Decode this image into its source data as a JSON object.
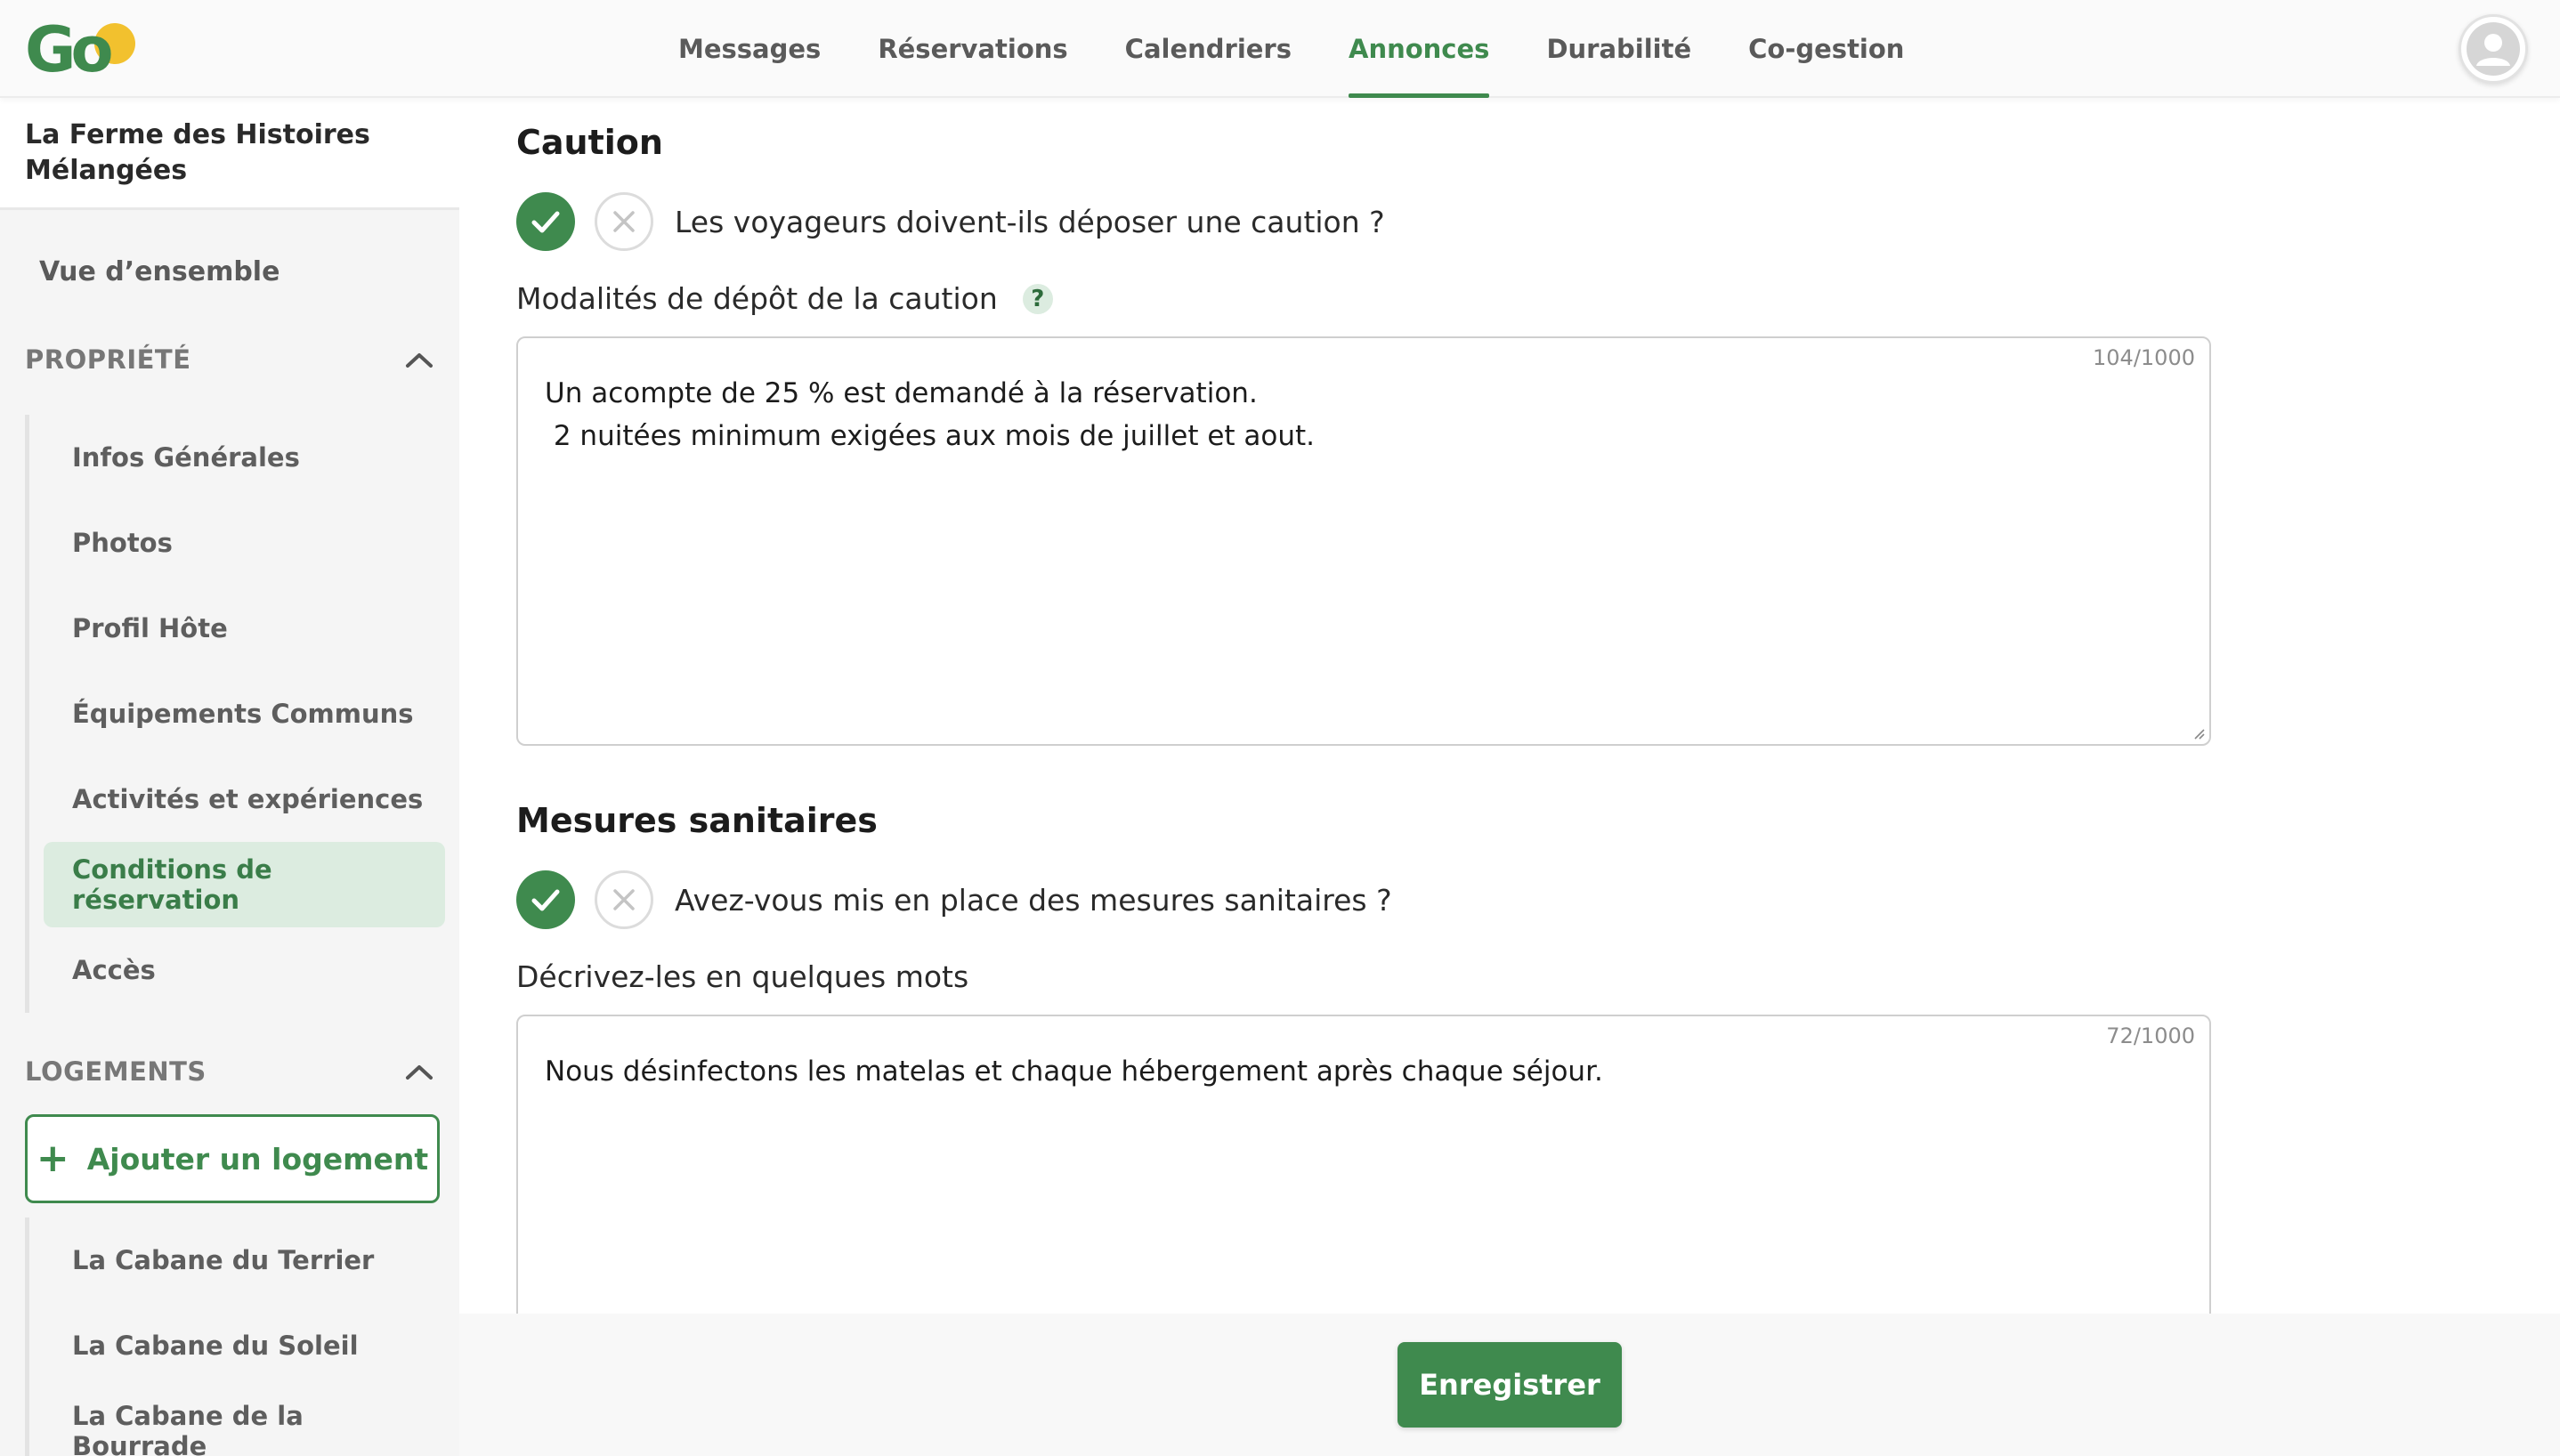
{
  "header": {
    "logo_text": "Go",
    "nav": [
      {
        "label": "Messages"
      },
      {
        "label": "Réservations"
      },
      {
        "label": "Calendriers"
      },
      {
        "label": "Annonces"
      },
      {
        "label": "Durabilité"
      },
      {
        "label": "Co-gestion"
      }
    ],
    "active_nav": "Annonces",
    "avatar_icon": "user-icon"
  },
  "sidebar": {
    "property_name": "La Ferme des Histoires Mélangées",
    "overview": "Vue d’ensemble",
    "property_section": {
      "label": "PROPRIÉTÉ",
      "items": [
        {
          "label": "Infos Générales"
        },
        {
          "label": "Photos"
        },
        {
          "label": "Profil Hôte"
        },
        {
          "label": "Équipements Communs"
        },
        {
          "label": "Activités et expériences"
        },
        {
          "label": "Conditions de réservation"
        },
        {
          "label": "Accès"
        }
      ],
      "active_item": "Conditions de réservation"
    },
    "lodging_section": {
      "label": "LOGEMENTS",
      "add_button": "Ajouter un logement",
      "items": [
        {
          "label": "La Cabane du Terrier"
        },
        {
          "label": "La Cabane du Soleil"
        },
        {
          "label": "La Cabane de la Bourrade"
        }
      ]
    }
  },
  "main": {
    "deposit": {
      "title": "Caution",
      "question": "Les voyageurs doivent-ils déposer une caution ?",
      "answer": "yes",
      "field_label": "Modalités de dépôt de la caution",
      "help_glyph": "?",
      "counter": "104/1000",
      "text": "Un acompte de 25 % est demandé à la réservation.\n 2 nuitées minimum exigées aux mois de juillet et aout."
    },
    "sanitary": {
      "title": "Mesures sanitaires",
      "question": "Avez-vous mis en place des mesures sanitaires ?",
      "answer": "yes",
      "field_label": "Décrivez-les en quelques mots",
      "counter": "72/1000",
      "text": "Nous désinfectons les matelas et chaque hébergement après chaque séjour."
    }
  },
  "footer": {
    "save_label": "Enregistrer"
  },
  "colors": {
    "brand_green": "#3f8a4e",
    "active_bg": "#dcece0",
    "logo_sun": "#f2c12e"
  }
}
